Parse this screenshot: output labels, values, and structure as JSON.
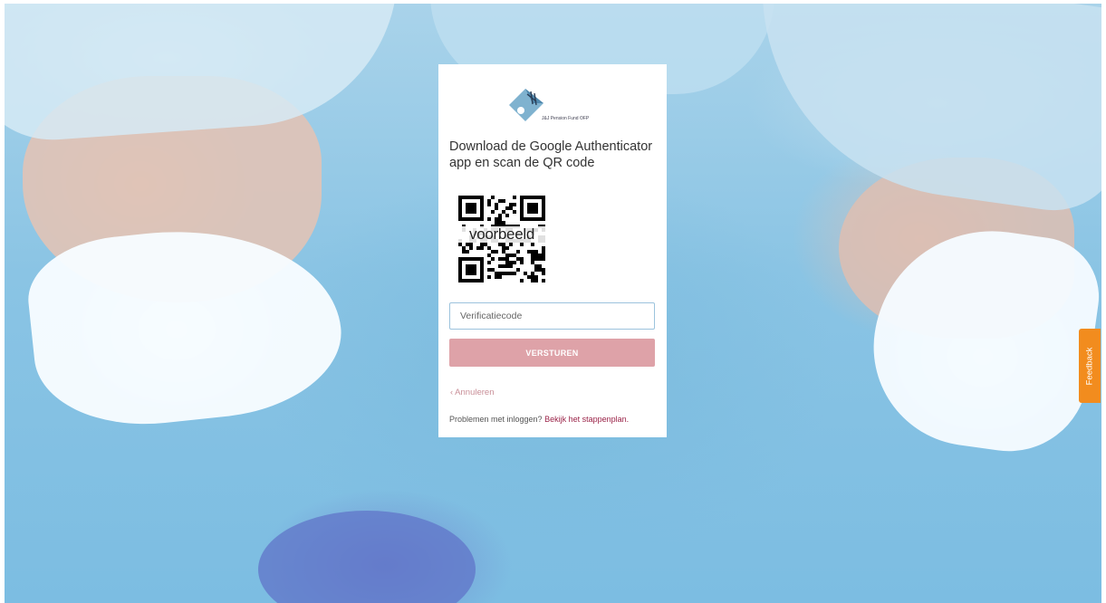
{
  "brand": {
    "logo_text": "J&J Pension Fund OFP",
    "colors": {
      "accent": "#9a2247",
      "button_bg": "#dea2a8",
      "feedback_tab": "#f28c1e",
      "input_border": "#9cc3dd"
    }
  },
  "login": {
    "heading": "Download de Google Authenticator app en scan de QR code",
    "qr_overlay_text": "voorbeeld",
    "code_input": {
      "value": "",
      "placeholder": "Verificatiecode"
    },
    "submit_label": "VERSTUREN",
    "cancel_label": "Annuleren",
    "help_text": "Problemen met inloggen?",
    "help_link": "Bekijk het stappenplan."
  },
  "feedback": {
    "label": "Feedback"
  },
  "icons": {
    "logo": "pension-fund-logo",
    "cancel": "chevron-left-icon",
    "qr": "qr-code-image"
  }
}
